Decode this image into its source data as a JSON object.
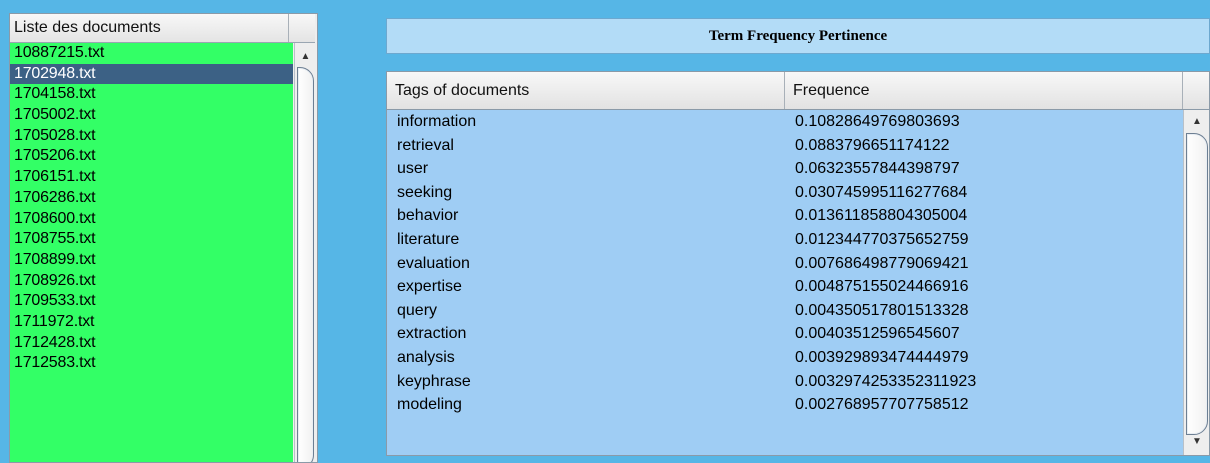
{
  "documents_panel": {
    "header": "Liste des documents",
    "items": [
      "10887215.txt",
      "1702948.txt",
      "1704158.txt",
      "1705002.txt",
      "1705028.txt",
      "1705206.txt",
      "1706151.txt",
      "1706286.txt",
      "1708600.txt",
      "1708755.txt",
      "1708899.txt",
      "1708926.txt",
      "1709533.txt",
      "1711972.txt",
      "1712428.txt",
      "1712583.txt"
    ],
    "selected": "1702948.txt"
  },
  "title": "Term Frequency Pertinence",
  "table": {
    "columns": [
      "Tags of documents",
      "Frequence"
    ],
    "rows": [
      [
        "information",
        "0.10828649769803693"
      ],
      [
        "retrieval",
        "0.0883796651174122"
      ],
      [
        "user",
        "0.06323557844398797"
      ],
      [
        "seeking",
        "0.030745995116277684"
      ],
      [
        "behavior",
        "0.013611858804305004"
      ],
      [
        "literature",
        "0.012344770375652759"
      ],
      [
        "evaluation",
        "0.007686498779069421"
      ],
      [
        "expertise",
        "0.004875155024466916"
      ],
      [
        "query",
        "0.004350517801513328"
      ],
      [
        "extraction",
        "0.00403512596545607"
      ],
      [
        "analysis",
        "0.003929893474444979"
      ],
      [
        "keyphrase",
        "0.0032974253352311923"
      ],
      [
        "modeling",
        "0.002768957707758512"
      ]
    ]
  },
  "icons": {
    "scroll_up": "▲",
    "scroll_down": "▼"
  },
  "colors": {
    "background": "#56b6e6",
    "list_background": "#33ff66",
    "selection": "#3c6185",
    "table_background": "#9fcdf4"
  }
}
